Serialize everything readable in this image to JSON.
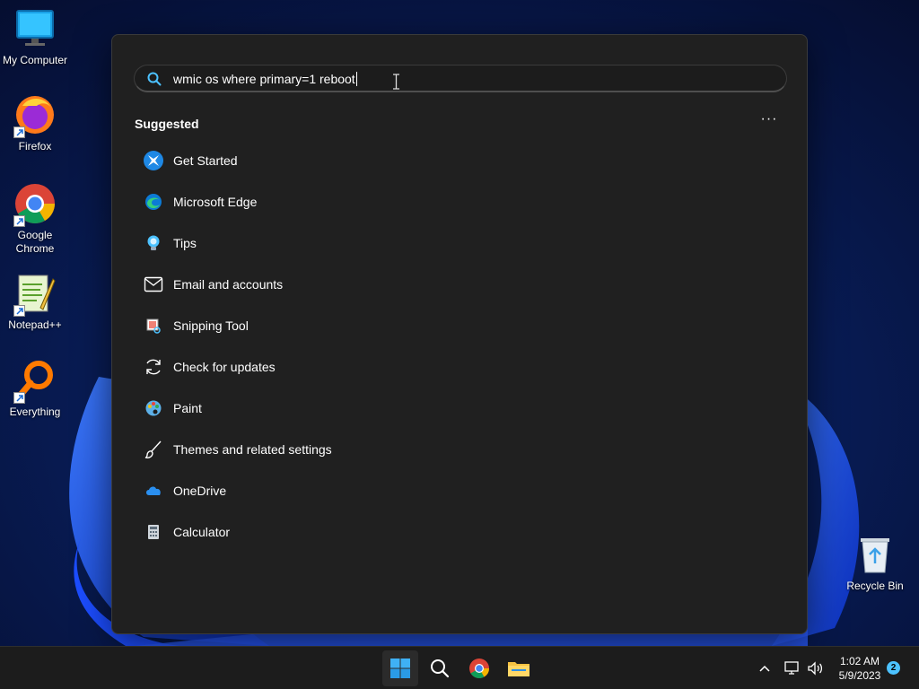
{
  "desktop": {
    "icons": [
      {
        "label": "My Computer"
      },
      {
        "label": "Firefox"
      },
      {
        "label": "Google Chrome"
      },
      {
        "label": "Notepad++"
      },
      {
        "label": "Everything"
      }
    ],
    "recycle_bin": {
      "label": "Recycle Bin"
    }
  },
  "search_panel": {
    "query": "wmic os where primary=1 reboot",
    "section_title": "Suggested",
    "more_label": "···",
    "suggestions": [
      {
        "label": "Get Started",
        "icon": "get-started-icon"
      },
      {
        "label": "Microsoft Edge",
        "icon": "edge-icon"
      },
      {
        "label": "Tips",
        "icon": "tips-lightbulb-icon"
      },
      {
        "label": "Email and accounts",
        "icon": "mail-envelope-icon"
      },
      {
        "label": "Snipping Tool",
        "icon": "snipping-tool-icon"
      },
      {
        "label": "Check for updates",
        "icon": "refresh-icon"
      },
      {
        "label": "Paint",
        "icon": "paint-palette-icon"
      },
      {
        "label": "Themes and related settings",
        "icon": "brush-icon"
      },
      {
        "label": "OneDrive",
        "icon": "onedrive-cloud-icon"
      },
      {
        "label": "Calculator",
        "icon": "calculator-icon"
      }
    ]
  },
  "taskbar": {
    "clock_time": "1:02 AM",
    "clock_date": "5/9/2023",
    "notification_count": "2"
  },
  "colors": {
    "accent": "#4cc2ff",
    "panel_bg": "#202020",
    "taskbar_bg": "#1c1c1c"
  }
}
